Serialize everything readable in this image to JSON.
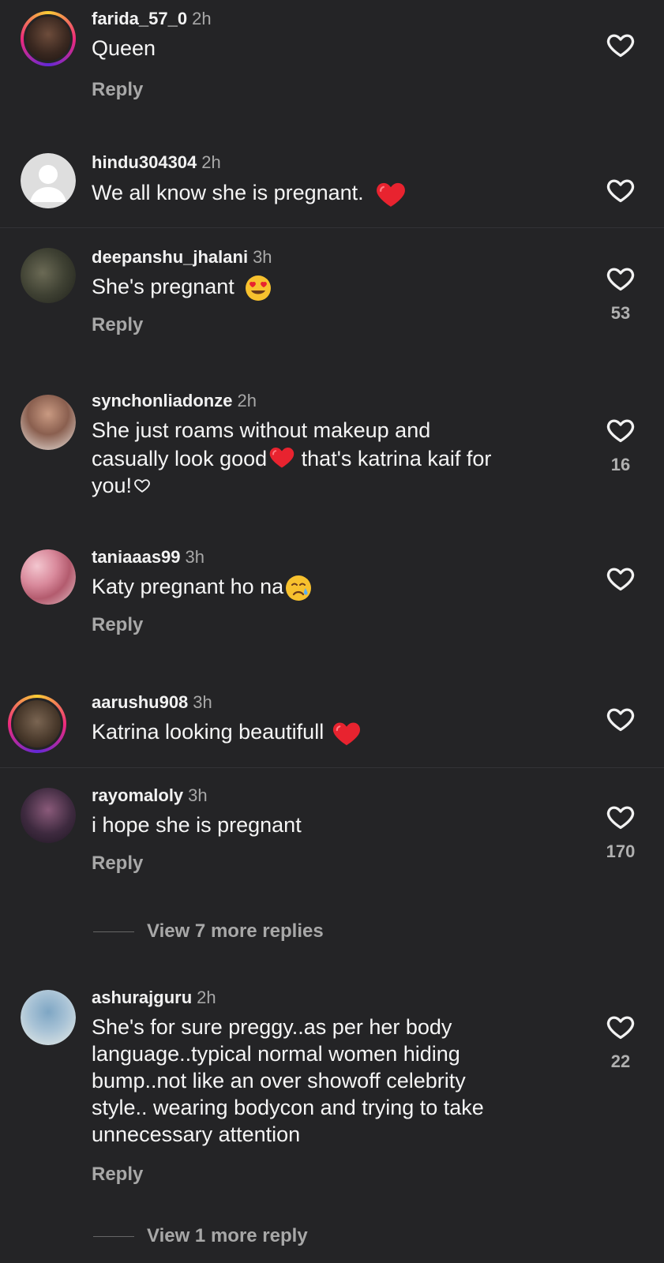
{
  "comments": [
    {
      "username": "farida_57_0",
      "time": "2h",
      "text": "Queen",
      "reply": "Reply",
      "likes": ""
    },
    {
      "username": "hindu304304",
      "time": "2h",
      "text": "We all know she is pregnant.",
      "reply": "",
      "likes": ""
    },
    {
      "username": "deepanshu_jhalani",
      "time": "3h",
      "text": "She's pregnant",
      "reply": "Reply",
      "likes": "53"
    },
    {
      "username": "synchonliadonze",
      "time": "2h",
      "text_line1": "She just roams without makeup and",
      "text_line2a": "casually look good",
      "text_line2b": " that's katrina kaif for",
      "text_line3": "you!",
      "reply": "",
      "likes": "16"
    },
    {
      "username": "taniaaas99",
      "time": "3h",
      "text": "Katy pregnant ho na",
      "reply": "Reply",
      "likes": ""
    },
    {
      "username": "aarushu908",
      "time": "3h",
      "text": "Katrina looking beautifull",
      "reply": "",
      "likes": ""
    },
    {
      "username": "rayomaloly",
      "time": "3h",
      "text": "i hope she is pregnant",
      "reply": "Reply",
      "likes": "170",
      "view_more": "View 7 more replies"
    },
    {
      "username": "ashurajguru",
      "time": "2h",
      "text_lines": [
        "She's for sure preggy..as per her body",
        "language..typical normal women hiding",
        "bump..not like an over showoff celebrity",
        "style.. wearing bodycon and trying to take",
        "unnecessary attention"
      ],
      "reply": "Reply",
      "likes": "22",
      "view_more": "View 1 more reply"
    }
  ],
  "colors": {
    "background": "#242426",
    "heart_emoji": "#e8232f",
    "secondary_text": "#a8a8a8"
  },
  "icons": {
    "like": "heart-outline-icon",
    "heart_emoji": "red-heart-emoji",
    "heart_eyes": "heart-eyes-emoji",
    "crying": "crying-face-emoji",
    "white_heart": "white-heart-emoji"
  }
}
